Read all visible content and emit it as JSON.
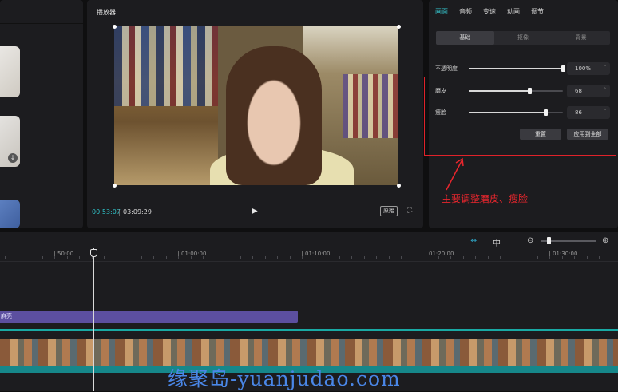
{
  "player": {
    "title": "播放器",
    "timecode_current": "00:53:07",
    "timecode_total": "03:09:29",
    "ratio_label": "原始"
  },
  "properties": {
    "tabs": [
      {
        "label": "画面",
        "active": true
      },
      {
        "label": "音频",
        "active": false
      },
      {
        "label": "变速",
        "active": false
      },
      {
        "label": "动画",
        "active": false
      },
      {
        "label": "调节",
        "active": false
      }
    ],
    "segments": [
      {
        "label": "基础",
        "active": true
      },
      {
        "label": "抠像",
        "active": false
      },
      {
        "label": "背景",
        "active": false
      }
    ],
    "opacity": {
      "label": "不透明度",
      "value": "100%",
      "level": 1.0
    },
    "smooth_skin": {
      "label": "磨皮",
      "value": "68",
      "level": 0.64
    },
    "slim_face": {
      "label": "瘦脸",
      "value": "86",
      "level": 0.81
    },
    "reset_label": "重置",
    "apply_all_label": "应用到全部"
  },
  "annotation": {
    "text": "主要调整磨皮、瘦脸",
    "color": "#e8262d"
  },
  "timeline": {
    "ticks": [
      {
        "label": "50:00"
      },
      {
        "label": "01:00:00"
      },
      {
        "label": "01:10:00"
      },
      {
        "label": "01:20:00"
      },
      {
        "label": "01:30:00"
      }
    ],
    "text_clip_label": "麻亮"
  },
  "watermark": "缘聚岛-yuanjudao.com",
  "colors": {
    "accent": "#35c8d0",
    "highlight": "#e0222a",
    "text_clip": "#5c4fa0",
    "track_teal": "#19a9a4"
  }
}
